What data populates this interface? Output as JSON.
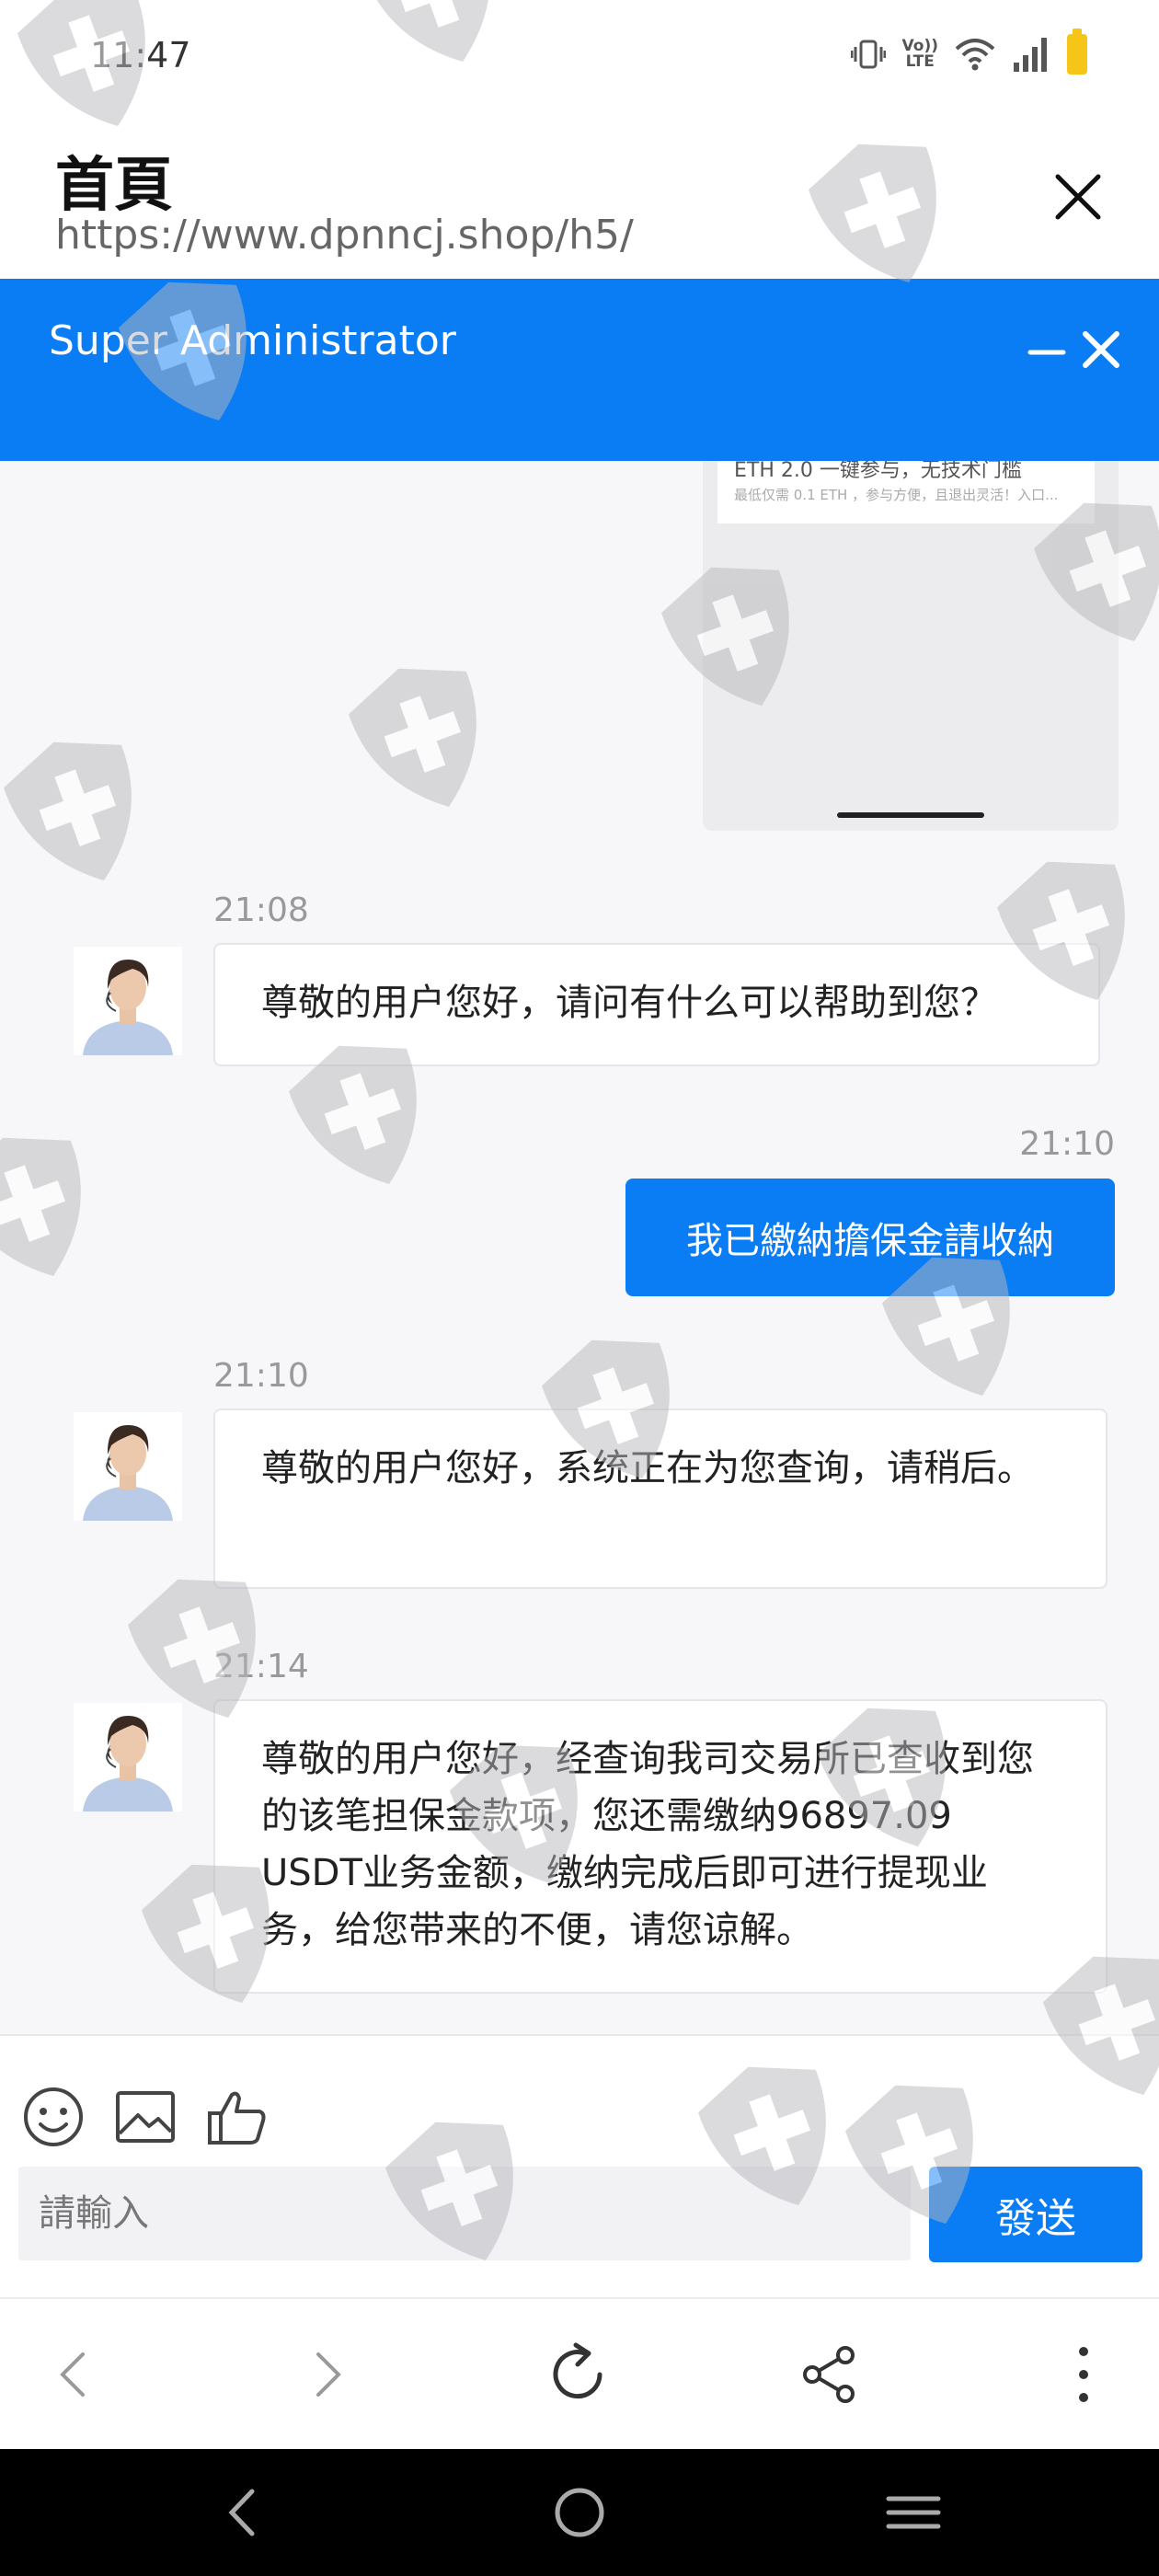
{
  "status_bar": {
    "time": "11:47",
    "icons": [
      "vibrate-icon",
      "volte-icon",
      "wifi-icon",
      "signal-icon",
      "battery-icon"
    ],
    "volte_label_top": "Vo))",
    "volte_label_bottom": "LTE"
  },
  "browser": {
    "page_title": "首頁",
    "url": "https://www.dpnncj.shop/h5/"
  },
  "chat_header": {
    "title": "Super Administrator"
  },
  "shared_image": {
    "title": "ETH 2.0 一键参与，无技术门槛",
    "subtitle": "最低仅需 0.1 ETH ，参与方便，且退出灵活！入口..."
  },
  "messages": [
    {
      "direction": "in",
      "time": "21:08",
      "text": "尊敬的用户您好，请问有什么可以帮助到您？"
    },
    {
      "direction": "out",
      "time": "21:10",
      "text": "我已繳納擔保金請收納"
    },
    {
      "direction": "in",
      "time": "21:10",
      "text": "尊敬的用户您好，系统正在为您查询，请稍后。"
    },
    {
      "direction": "in",
      "time": "21:14",
      "text": "尊敬的用户您好，经查询我司交易所已查收到您的该笔担保金款项，您还需缴纳96897.09 USDT业务金额，缴纳完成后即可进行提现业务，给您带来的不便，请您谅解。"
    }
  ],
  "composer": {
    "placeholder": "請輸入",
    "send_label": "發送",
    "tools": [
      "emoji-icon",
      "image-icon",
      "thumbs-up-icon"
    ]
  },
  "colors": {
    "brand_blue": "#0a7cf4",
    "chat_background": "#f7f7f9",
    "battery": "#f5c518"
  }
}
